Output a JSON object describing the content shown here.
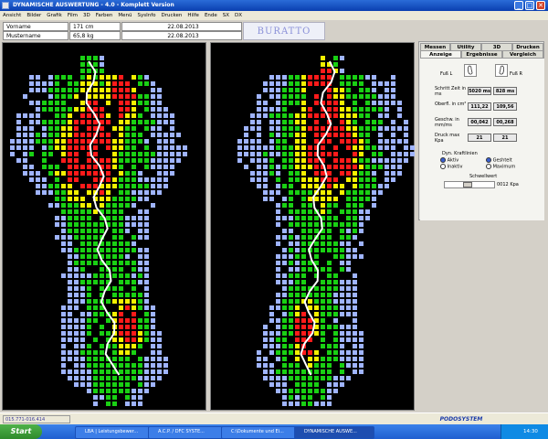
{
  "window": {
    "title": "DYNAMISCHE AUSWERTUNG     - 4.0 - Komplett Version",
    "buttons": [
      "_",
      "□",
      "✕"
    ]
  },
  "menu": [
    "Ansicht",
    "Bilder",
    "Grafik",
    "Film",
    "3D",
    "Farben",
    "Menü",
    "SysInfo",
    "Drucken",
    "Hilfe",
    "Ende",
    "SX",
    "DX"
  ],
  "header": {
    "first_name": "Vorname",
    "last_name": "Mustername",
    "height": "171 cm",
    "weight": "65,8 kg",
    "date1": "22.08.2013",
    "date2": "22.08.2013",
    "logo": "BURATTO"
  },
  "tabs_top": [
    "Messen",
    "Utility",
    "3D",
    "Drucken"
  ],
  "tabs_bottom": [
    "Anzeige",
    "Ergebnisse",
    "Vergleich"
  ],
  "results": {
    "foot_left": "Fuß L",
    "foot_right": "Fuß R",
    "step_time_label": "Schritt Zeit in ms",
    "step_time_left": "5020 ms",
    "step_time_right": "828 ms",
    "surface_label": "Oberfl. in cm²",
    "surface_left": "111,22",
    "surface_right": "109,56",
    "speed_label": "Geschw. in mm/ms",
    "speed_left": "00,042",
    "speed_right": "00,268",
    "pressure_label": "Druck max Kpa",
    "pressure_left": "21",
    "pressure_right": "21",
    "force_lines_label": "Dyn. Kraftlinien",
    "option_active": "Aktiv",
    "option_inactive": "Inaktiv",
    "option_smoothed": "Geshtelt",
    "option_maximum": "Maximum",
    "threshold_label": "Schwellwert",
    "threshold_value": "0012 Kpa",
    "threshold_level": 0.45
  },
  "status": {
    "left": "015.771-016.414",
    "logo": "PODOSYSTEM"
  },
  "taskbar": {
    "start": "Start",
    "tasks": [
      "LBA | Leistungsbewer...",
      "A.C.P. / DFC SYSTE...",
      "C:\\Dokumente und Ei...",
      "DYNAMISCHE AUSWE..."
    ],
    "clock": "14:30"
  },
  "colors": {
    "low": "#9fb4ff",
    "mid": "#19d013",
    "high": "#f3f000",
    "max": "#ff1a1a",
    "titlebar": "#0a3fb0"
  }
}
